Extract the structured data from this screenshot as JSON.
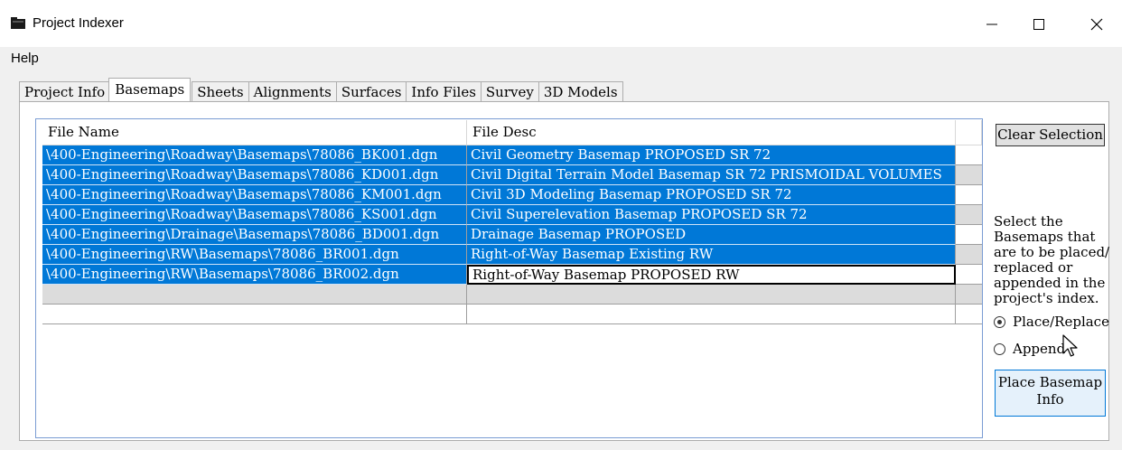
{
  "window": {
    "title": "Project Indexer",
    "icon": "folder-icon"
  },
  "menu": {
    "help": "Help"
  },
  "tabs": [
    {
      "label": "Project Info",
      "active": false
    },
    {
      "label": "Basemaps",
      "active": true
    },
    {
      "label": "Sheets",
      "active": false
    },
    {
      "label": "Alignments",
      "active": false
    },
    {
      "label": "Surfaces",
      "active": false
    },
    {
      "label": "Info Files",
      "active": false
    },
    {
      "label": "Survey",
      "active": false
    },
    {
      "label": "3D Models",
      "active": false
    }
  ],
  "grid": {
    "columns": [
      "File Name",
      "File Desc"
    ],
    "rows": [
      {
        "file_name": "\\400-Engineering\\Roadway\\Basemaps\\78086_BK001.dgn",
        "file_desc": "Civil Geometry Basemap  PROPOSED SR 72"
      },
      {
        "file_name": "\\400-Engineering\\Roadway\\Basemaps\\78086_KD001.dgn",
        "file_desc": "Civil Digital Terrain Model Basemap  SR 72 PRISMOIDAL VOLUMES"
      },
      {
        "file_name": "\\400-Engineering\\Roadway\\Basemaps\\78086_KM001.dgn",
        "file_desc": "Civil 3D Modeling Basemap  PROPOSED SR 72"
      },
      {
        "file_name": "\\400-Engineering\\Roadway\\Basemaps\\78086_KS001.dgn",
        "file_desc": "Civil Superelevation Basemap  PROPOSED SR 72"
      },
      {
        "file_name": "\\400-Engineering\\Drainage\\Basemaps\\78086_BD001.dgn",
        "file_desc": "Drainage Basemap  PROPOSED"
      },
      {
        "file_name": "\\400-Engineering\\RW\\Basemaps\\78086_BR001.dgn",
        "file_desc": "Right-of-Way Basemap  Existing RW"
      },
      {
        "file_name": "\\400-Engineering\\RW\\Basemaps\\78086_BR002.dgn",
        "file_desc": "Right-of-Way Basemap  PROPOSED RW"
      }
    ]
  },
  "side": {
    "clear_selection": "Clear Selection",
    "instructions": "Select the Basemaps that are to be placed/ replaced or appended in the project's index.",
    "radio_place_replace": "Place/Replace",
    "radio_append": "Append",
    "selected_mode": "Place/Replace",
    "place_button_line1": "Place Basemap",
    "place_button_line2": "Info"
  },
  "colors": {
    "selection": "#0078d7",
    "window_bg": "#f0f0f0"
  }
}
